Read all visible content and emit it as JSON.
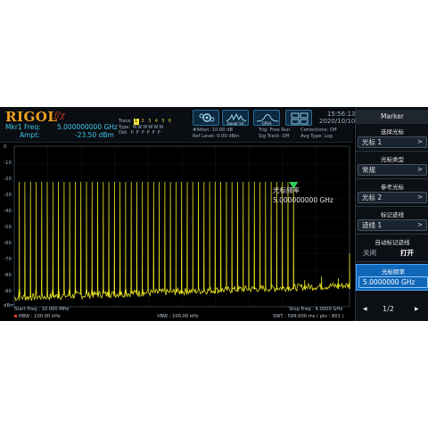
{
  "header": {
    "brand": "RIGOL",
    "brand_sub": "ƒ/χ",
    "marker_freq_label": "Mkr1 Freq:",
    "marker_freq_value": "5.000000000 GHz",
    "marker_ampt_label": "Ampt:",
    "marker_ampt_value": "-23.50 dBm",
    "trace_label": "Trace:",
    "trace_numbers": [
      "1",
      "2",
      "3",
      "4",
      "5",
      "6"
    ],
    "type_label": "Type:",
    "type_values": [
      "M",
      "W",
      "W",
      "W",
      "W",
      "W"
    ],
    "det_label": "Det:",
    "det_values": [
      "P",
      "P",
      "P",
      "P",
      "P",
      "P"
    ],
    "icons": [
      {
        "name": "settings-gear-icon",
        "label": ""
      },
      {
        "name": "swept-sa-icon",
        "label": "Swept SA"
      },
      {
        "name": "gpsa-icon",
        "label": "GPSA"
      },
      {
        "name": "layout-grid-icon",
        "label": ""
      }
    ],
    "atten": "#Atten: 10.00 dB",
    "ref_level": "Ref Level: 0.00 dBm",
    "trig": "Trig: Free Run",
    "sig_track": "Sig Track: Off",
    "corrections": "Corrections: Off",
    "avg_type": "Avg Type: Log",
    "time": "15:56:13",
    "date": "2020/10/10"
  },
  "plot": {
    "y_labels": [
      "0",
      "-10",
      "-20",
      "-30",
      "-40",
      "-50",
      "-60",
      "-70",
      "-80",
      "-90"
    ],
    "y_unit": "dBm",
    "marker_readout_label": "光标频率",
    "marker_readout_value": "5.000000000 GHz",
    "marker_number": "1"
  },
  "chart_data": {
    "type": "line",
    "x_range": [
      0.01,
      6.0
    ],
    "x_unit": "GHz",
    "ylim": [
      -90,
      0
    ],
    "y_unit": "dBm",
    "grid": true,
    "series": [
      {
        "values_desc": "comb of harmonic spikes",
        "peak_level": -20,
        "peak_spacing_ghz": 0.1,
        "peak_start": 0.1,
        "peak_end": 5.0,
        "noise_floor_start": -85,
        "noise_floor_end": -78,
        "secondary_peaks": [
          5.2,
          5.5,
          5.8,
          6.0
        ],
        "secondary_peak_levels": [
          -75,
          -73,
          -74,
          -60
        ]
      }
    ],
    "marker": {
      "x": 5.0,
      "y": -23.5
    }
  },
  "footer": {
    "start_freq": "Start Freq : 10.000 MHz",
    "rbw": "RBW : 100.00 kHz",
    "vbw": "VBW : 100.00 kHz",
    "stop_freq": "Stop Freq : 6.0000 GHz",
    "swt": "SWT : 599.000 ms ( pts : 801 )"
  },
  "panel": {
    "title": "Marker",
    "items": [
      {
        "label": "选择光标",
        "value": "光标 1"
      },
      {
        "label": "光标类型",
        "value": "常规"
      },
      {
        "label": "参考光标",
        "value": "光标 2"
      },
      {
        "label": "标记迹线",
        "value": "迹线 1"
      }
    ],
    "auto_trace": {
      "label": "自动标记迹线",
      "off": "关闭",
      "on": "打开"
    },
    "marker_freq": {
      "label": "光标频率",
      "value": "5.0000000 GHz"
    },
    "pager": {
      "page": "1/2"
    }
  },
  "colors": {
    "trace": "#e7e21f",
    "marker": "#2ed35a",
    "accent": "#1067b8",
    "label": "#3fc8ea"
  }
}
